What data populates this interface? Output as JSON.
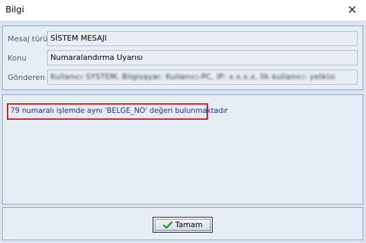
{
  "window": {
    "title": "Bilgi",
    "close_glyph": "✕"
  },
  "info": {
    "message_type": {
      "label": "Mesaj türü",
      "value": "SİSTEM MESAJI"
    },
    "subject": {
      "label": "Konu",
      "value": "Numaralandırma Uyarısı"
    },
    "sender": {
      "label": "Gönderen",
      "value": "Kullanıcı SYSTEM, Bilgisayar: Kullanıcı-PC, IP: x.x.x.x, İlk kullanıcı: yetkisi"
    }
  },
  "message": {
    "text": "79 numaralı işlemde aynı 'BELGE_NO' değeri bulunmaktadır"
  },
  "footer": {
    "ok_label": "Tamam",
    "ok_icon": "check-icon"
  },
  "colors": {
    "highlight_border": "#e0141a",
    "message_text": "#1a2fa0",
    "panel_bg": "#e7edf5",
    "window_bg": "#dbe5f1"
  }
}
